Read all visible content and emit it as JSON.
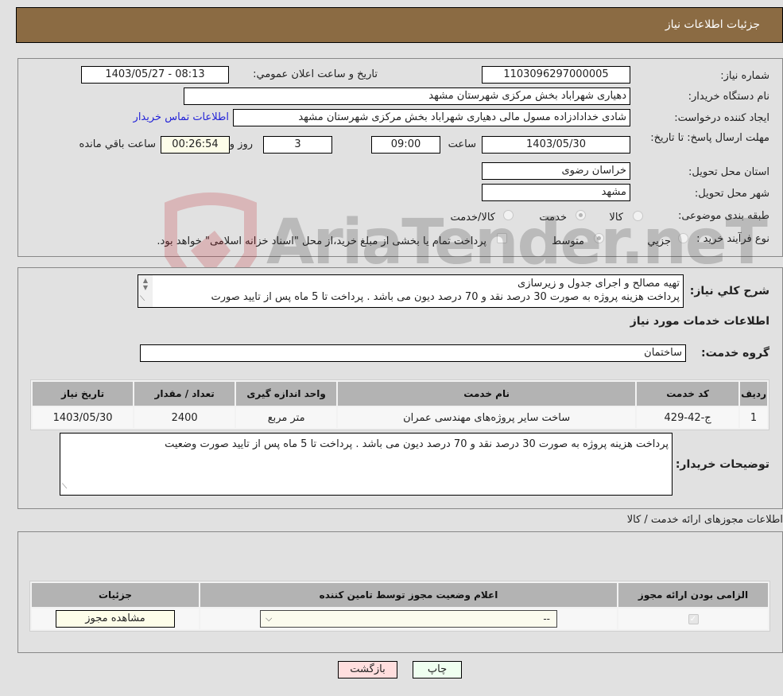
{
  "header": {
    "title": "جزئیات اطلاعات نیاز"
  },
  "details": {
    "need_number_label": "شماره نیاز:",
    "need_number": "1103096297000005",
    "announce_label": "تاریخ و ساعت اعلان عمومي:",
    "announce_value": "1403/05/27 - 08:13",
    "buyer_org_label": "نام دستگاه خریدار:",
    "buyer_org": "دهیاری شهراباد بخش مرکزی شهرستان مشهد",
    "creator_label": "ایجاد کننده درخواست:",
    "creator": "شادی خدادادزاده مسول مالی دهیاری شهراباد بخش مرکزی شهرستان مشهد",
    "contact_link": "اطلاعات تماس خریدار",
    "deadline_label": "مهلت ارسال پاسخ: تا تاریخ:",
    "deadline_date": "1403/05/30",
    "time_label": "ساعت",
    "deadline_time": "09:00",
    "days_value": "3",
    "days_label": "روز و",
    "remaining_value": "00:26:54",
    "remaining_label": "ساعت باقي مانده",
    "province_label": "استان محل تحویل:",
    "province": "خراسان رضوی",
    "city_label": "شهر محل تحویل:",
    "city": "مشهد",
    "category_label": "طبقه بندی موضوعی:",
    "category_options": [
      {
        "label": "کالا",
        "selected": false
      },
      {
        "label": "خدمت",
        "selected": true
      },
      {
        "label": "کالا/خدمت",
        "selected": false
      }
    ],
    "process_label": "نوع فرآیند خرید :",
    "process_options": [
      {
        "label": "جزيي",
        "selected": false
      },
      {
        "label": "متوسط",
        "selected": true
      }
    ],
    "treasury_note": "پرداخت تمام یا بخشی از مبلغ خرید،از محل \"اسناد خزانه اسلامی\" خواهد بود."
  },
  "description": {
    "label": "شرح کلي نیاز:",
    "line1": "تهیه مصالح و اجرای جدول و زیرسازی",
    "line2": "پرداخت هزینه پروژه به صورت 30 درصد نقد و 70 درصد دیون می باشد . پرداخت تا 5 ماه پس از تایید صورت"
  },
  "services": {
    "section_title": "اطلاعات خدمات مورد نیاز",
    "group_label": "گروه خدمت:",
    "group_value": "ساختمان",
    "columns": [
      "ردیف",
      "کد خدمت",
      "نام خدمت",
      "واحد اندازه گیری",
      "تعداد / مقدار",
      "تاریخ نیاز"
    ],
    "rows": [
      [
        "1",
        "ج-42-429",
        "ساخت سایر پروژه‌های مهندسی عمران",
        "متر مربع",
        "2400",
        "1403/05/30"
      ]
    ]
  },
  "buyer_notes": {
    "label": "توضیحات خریدار:",
    "text": "پرداخت هزینه پروژه به صورت 30 درصد نقد و 70 درصد دیون می باشد . پرداخت تا 5 ماه پس از تایید صورت وضعیت"
  },
  "permits": {
    "section_title": "اطلاعات مجوزهای ارائه خدمت / کالا",
    "columns": [
      "الزامی بودن ارائه مجوز",
      "اعلام وضعیت مجوز توسط تامین کننده",
      "جزئیات"
    ],
    "row": {
      "required": true,
      "status_value": "--",
      "details_button": "مشاهده مجوز"
    }
  },
  "footer": {
    "print_button": "چاپ",
    "back_button": "بازگشت"
  },
  "watermark": {
    "text": "AriaTender.neT"
  },
  "colors": {
    "header_bg": "#8b6b43",
    "link": "#2323d8",
    "print_bg": "#effff0",
    "back_bg": "#ffdede",
    "ivory": "#fdfde9"
  }
}
